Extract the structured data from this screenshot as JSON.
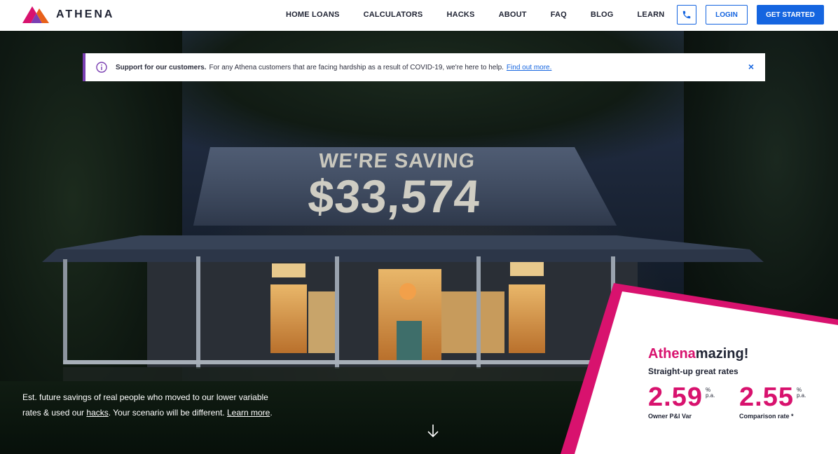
{
  "brand": {
    "name": "ATHENA"
  },
  "nav": {
    "links": [
      "HOME LOANS",
      "CALCULATORS",
      "HACKS",
      "ABOUT",
      "FAQ",
      "BLOG",
      "LEARN"
    ],
    "login_label": "LOGIN",
    "get_started_label": "GET STARTED",
    "phone_icon": "phone-icon"
  },
  "alert": {
    "strong": "Support for our customers.",
    "text": "For any Athena customers that are facing hardship as a result of COVID-19, we're here to help.",
    "link": "Find out more.",
    "close": "×",
    "icon": "info-icon"
  },
  "hero": {
    "roof_line1": "WE'RE SAVING",
    "roof_line2": "$33,574",
    "caption_part1": "Est. future savings of real people who moved to our lower variable rates & used our ",
    "caption_link1": "hacks",
    "caption_part2": ". Your scenario will be different. ",
    "caption_link2": "Learn more",
    "caption_part3": "."
  },
  "rates": {
    "title_brand": "Athena",
    "title_rest": "mazing!",
    "subtitle": "Straight-up great rates",
    "items": [
      {
        "value": "2.59",
        "unit_top": "%",
        "unit_bottom": "p.a.",
        "label": "Owner P&I Var"
      },
      {
        "value": "2.55",
        "unit_top": "%",
        "unit_bottom": "p.a.",
        "label": "Comparison rate *"
      }
    ]
  },
  "colors": {
    "accent_blue": "#1565e0",
    "brand_pink": "#d8126e",
    "alert_purple": "#7a3fb2"
  }
}
